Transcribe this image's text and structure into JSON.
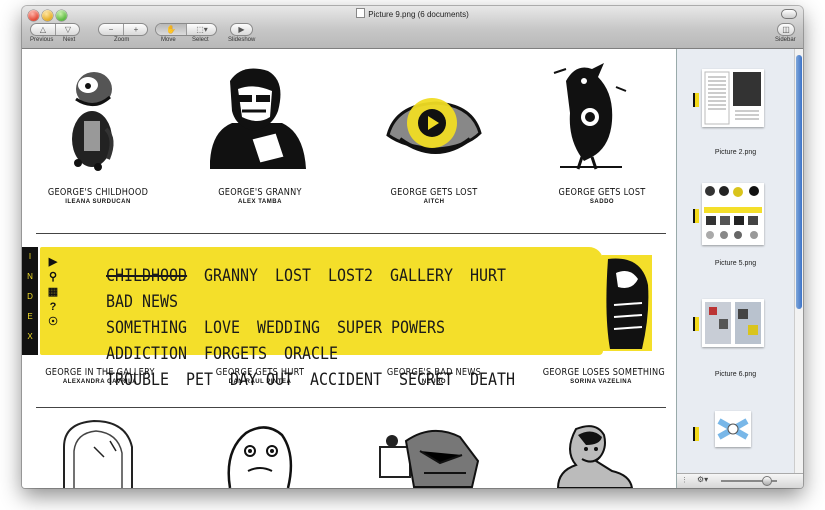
{
  "window": {
    "title": "Picture 9.png (6 documents)"
  },
  "toolbar": {
    "previous_label": "Previous",
    "next_label": "Next",
    "zoom_label": "Zoom",
    "move_label": "Move",
    "select_label": "Select",
    "slideshow_label": "Slideshow",
    "sidebar_label": "Sidebar"
  },
  "page": {
    "row1": [
      {
        "title": "GEORGE'S CHILDHOOD",
        "author": "ILEANA SURDUCAN"
      },
      {
        "title": "GEORGE'S GRANNY",
        "author": "ALEX TAMBA"
      },
      {
        "title": "GEORGE GETS LOST",
        "author": "AITCH"
      },
      {
        "title": "GEORGE GETS LOST",
        "author": "SADDO"
      }
    ],
    "index_letters": [
      "I",
      "N",
      "D",
      "E",
      "X"
    ],
    "index_words": [
      "CHILDHOOD",
      "GRANNY",
      "LOST",
      "LOST2",
      "GALLERY",
      "HURT",
      "BAD NEWS",
      "SOMETHING",
      "LOVE",
      "WEDDING",
      "SUPER POWERS",
      "ADDICTION",
      "FORGETS",
      "ORACLE",
      "TROUBLE",
      "PET",
      "DAY OUT",
      "ACCIDENT",
      "SECRET",
      "DEATH"
    ],
    "row2": [
      {
        "title": "GEORGE IN THE GALLERY",
        "author": "ALEXANDRA GAVRILA"
      },
      {
        "title": "GEORGE GETS HURT",
        "author": "DAN-RAUL PINTEA"
      },
      {
        "title": "GEORGE'S BAD NEWS",
        "author": "NEURO"
      },
      {
        "title": "GEORGE LOSES SOMETHING",
        "author": "SORINA VAZELINA"
      }
    ]
  },
  "sidebar": {
    "items": [
      {
        "label": "Picture 2.png"
      },
      {
        "label": "Picture 5.png"
      },
      {
        "label": "Picture 6.png"
      }
    ]
  },
  "colors": {
    "accent_yellow": "#f4df2a",
    "selection_blue": "#3c73c8"
  }
}
